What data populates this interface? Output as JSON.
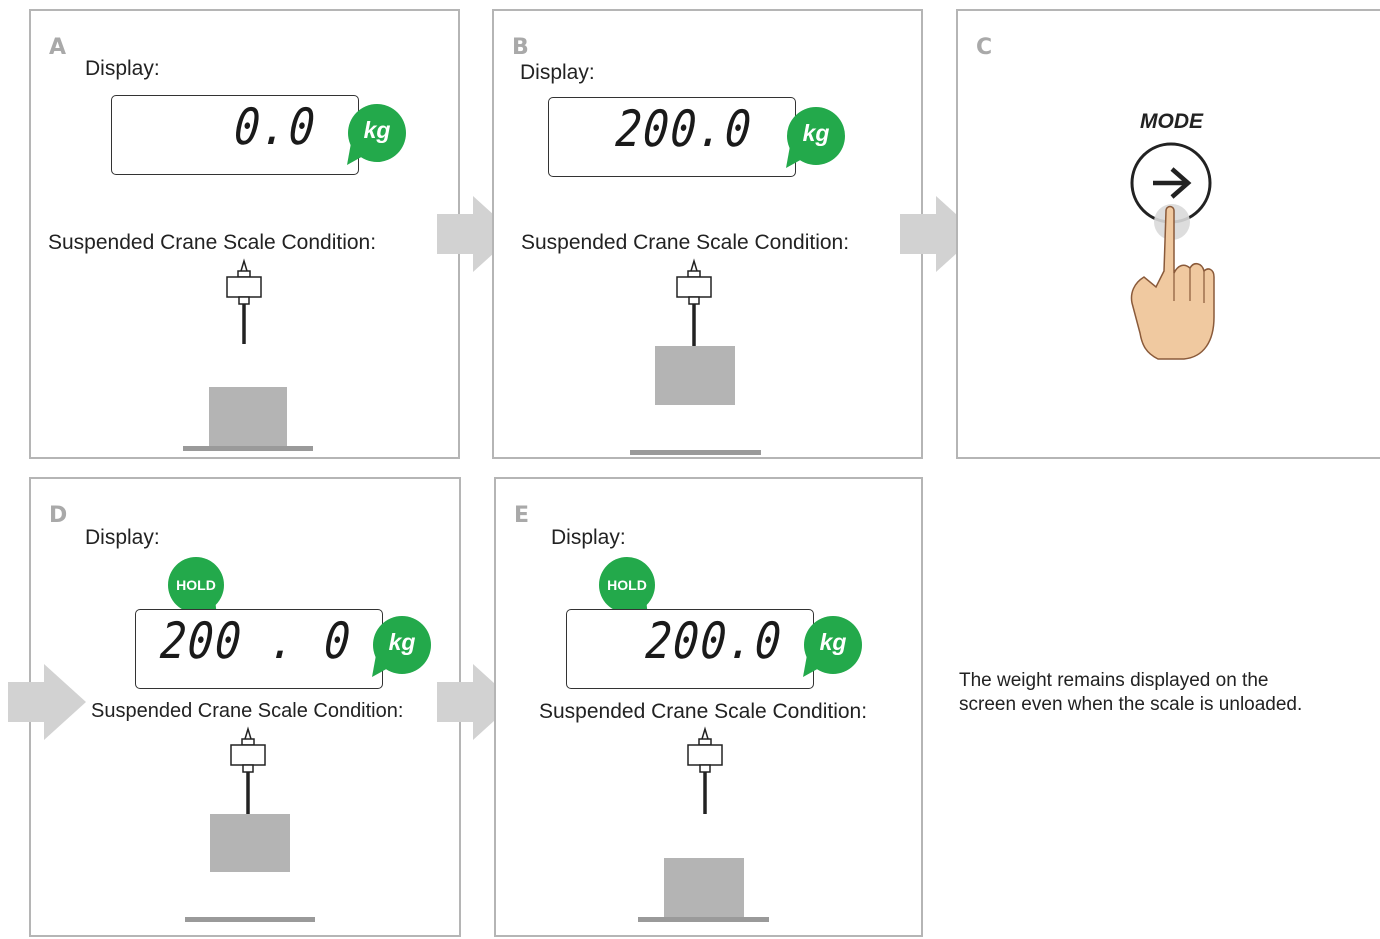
{
  "panels": {
    "a": {
      "letter": "A",
      "display_label": "Display:",
      "reading": "0.0",
      "unit": "kg",
      "condition_label": "Suspended Crane Scale Condition:"
    },
    "b": {
      "letter": "B",
      "display_label": "Display:",
      "reading": "200.0",
      "unit": "kg",
      "condition_label": "Suspended Crane Scale Condition:"
    },
    "c": {
      "letter": "C",
      "button_label": "MODE",
      "button_icon": "arrow-right-icon"
    },
    "d": {
      "letter": "D",
      "display_label": "Display:",
      "hold": "HOLD",
      "reading": "200 . 0",
      "unit": "kg",
      "condition_label": "Suspended Crane Scale Condition:"
    },
    "e": {
      "letter": "E",
      "display_label": "Display:",
      "hold": "HOLD",
      "reading": "200.0",
      "unit": "kg",
      "condition_label": "Suspended Crane Scale Condition:"
    }
  },
  "note": {
    "line1": "The weight remains displayed on the",
    "line2": "screen even when the scale is unloaded."
  },
  "colors": {
    "bubble_green": "#23a94b",
    "border_gray": "#b5b5b5",
    "load_gray": "#b4b4b4",
    "arrow_gray": "#d2d2d2",
    "skin": "#f0c9a0"
  }
}
